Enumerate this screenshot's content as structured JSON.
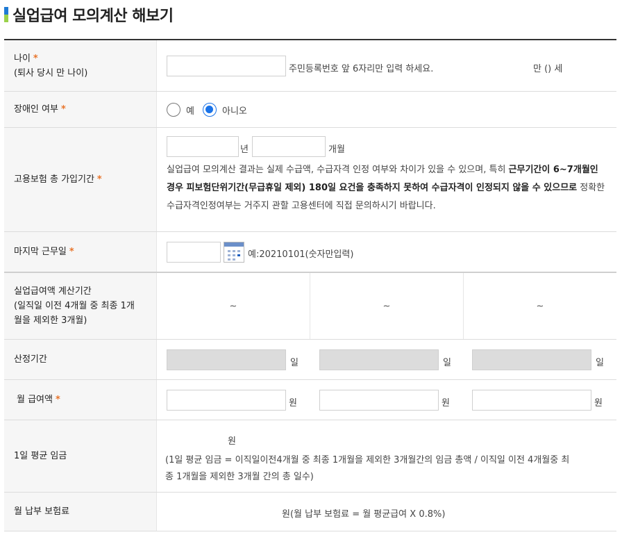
{
  "title": "실업급여 모의계산 해보기",
  "age": {
    "label": "나이",
    "sublabel": "(퇴사 당시 만 나이)",
    "hint": "주민등록번호 앞 6자리만 입력 하세요.",
    "result": "만 () 세",
    "value": ""
  },
  "disability": {
    "label": "장애인 여부",
    "options": [
      "예",
      "아니오"
    ],
    "selected": "아니오"
  },
  "insurance": {
    "label": "고용보험 총 가입기간",
    "year_unit": "년",
    "month_unit": "개월",
    "notice_1": "실업급여 모의계산 결과는 실제 수급액, 수급자격 인정 여부와 차이가 있을 수 있으며, 특히 ",
    "notice_bold": "근무기간이 6~7개월인 경우 피보험단위기간(무급휴일 제외) 180일 요건을 충족하지 못하여 수급자격이 인정되지 않을 수 있으므로",
    "notice_2": " 정확한 수급자격인정여부는 거주지 관할 고용센터에 직접 문의하시기 바랍니다."
  },
  "last_workday": {
    "label": "마지막 근무일",
    "hint": "예:20210101(숫자만입력)"
  },
  "calc_period": {
    "label_1": "실업급여액 계산기간",
    "label_2": "(일직일 이전 4개월 중 최종 1개",
    "label_3": "월을 제외한 3개월)",
    "cols": [
      "~",
      "~",
      "~"
    ]
  },
  "calc_days": {
    "label": "산정기간",
    "unit": "일"
  },
  "monthly_wage": {
    "label": "월 급여액",
    "unit": "원"
  },
  "daily_avg": {
    "label": "1일 평균 임금",
    "unit": "원",
    "formula_1": "(1일 평균 임금 = 이직일이전4개월 중 최종 1개월을 제외한 3개월간의 임금 총액 / 이직일 이전 4개월중 최",
    "formula_2": "종 1개월을 제외한 3개월 간의 총 일수)"
  },
  "monthly_premium": {
    "label": "월 납부 보험료",
    "formula": "원(월 납부 보험료 = 월 평균급여 X 0.8%)"
  },
  "colors": {
    "accent": "#1a73e8",
    "required": "#e8742a",
    "title_bar_top": "#1f7ad4",
    "title_bar_bottom": "#9bd24a"
  }
}
